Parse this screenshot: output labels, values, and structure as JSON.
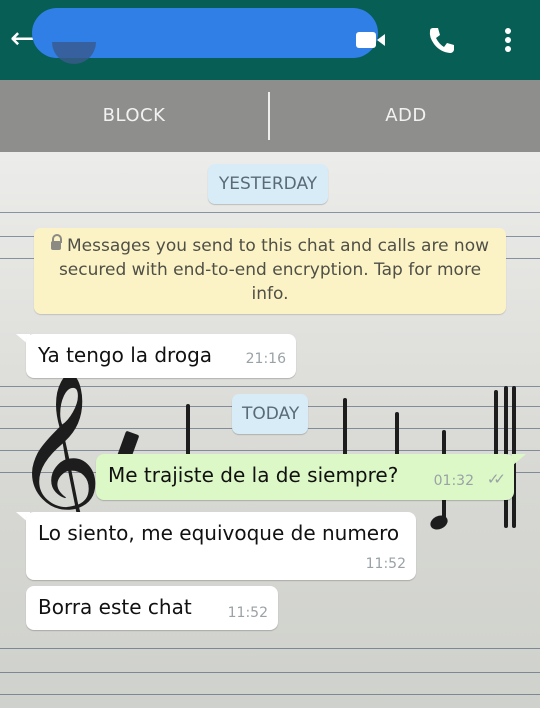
{
  "header": {
    "back_glyph": "←",
    "contact_name": "",
    "icons": [
      "back-arrow-icon",
      "video-call-icon",
      "phone-call-icon",
      "more-options-icon"
    ],
    "accent_color": "#075e54"
  },
  "actions": {
    "block_label": "BLOCK",
    "add_label": "ADD"
  },
  "chat": {
    "date_yesterday": "YESTERDAY",
    "date_today": "TODAY",
    "encryption_notice": "Messages you send to this chat and calls are now secured with end-to-end encryption. Tap for more info.",
    "messages": [
      {
        "direction": "in",
        "text": "Ya tengo la droga",
        "time": "21:16"
      },
      {
        "direction": "out",
        "text": "Me trajiste de la de siempre?",
        "time": "01:32",
        "status": "read"
      },
      {
        "direction": "in",
        "text": "Lo siento, me equivoque de numero",
        "time": "11:52"
      },
      {
        "direction": "in",
        "text": "Borra este chat",
        "time": "11:52"
      }
    ]
  }
}
